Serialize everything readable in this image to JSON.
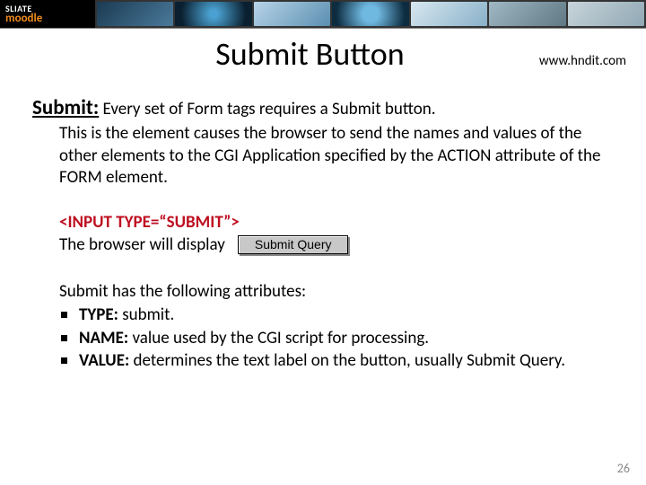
{
  "banner": {
    "logo_top": "SLIATE",
    "logo_bottom": "moodle"
  },
  "header": {
    "title": "Submit Button",
    "url": "www.hndit.com"
  },
  "lead": {
    "label": "Submit:",
    "text": " Every set of Form tags requires a Submit button."
  },
  "description": "This is the element causes the browser to send the names and values of the other elements to the CGI Application specified by the ACTION attribute of the FORM element.",
  "code": {
    "snippet": "<INPUT TYPE=“SUBMIT”>",
    "display_text": "The browser will display",
    "button_label": "Submit Query"
  },
  "attributes": {
    "intro": "Submit has the following attributes:",
    "items": [
      {
        "key": "TYPE:",
        "val": " submit."
      },
      {
        "key": "NAME:",
        "val": " value used by the CGI script for processing."
      },
      {
        "key": "VALUE:",
        "val": " determines the text label on the button, usually Submit Query."
      }
    ]
  },
  "page_number": "26"
}
